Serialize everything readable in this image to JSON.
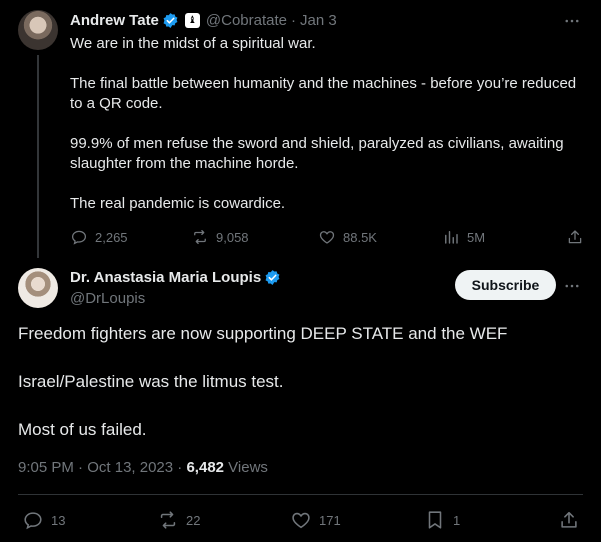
{
  "top_tweet": {
    "author_name": "Andrew Tate",
    "handle": "@Cobratate",
    "separator": "·",
    "date": "Jan 3",
    "affiliate_badge_glyph": "♝",
    "paragraphs": [
      "We are in the midst of a spiritual war.",
      "The final battle between humanity and the machines - before you’re reduced to a QR code.",
      "99.9% of men refuse the sword and shield, paralyzed as civilians, awaiting slaughter from the machine horde.",
      "The real pandemic is cowardice."
    ],
    "actions": {
      "replies": "2,265",
      "reposts": "9,058",
      "likes": "88.5K",
      "views": "5M"
    }
  },
  "main_tweet": {
    "author_name": "Dr. Anastasia Maria Loupis",
    "handle": "@DrLoupis",
    "subscribe_label": "Subscribe",
    "paragraphs": [
      "Freedom fighters are now supporting DEEP STATE and the WEF",
      "Israel/Palestine was the litmus test.",
      "Most of us failed."
    ],
    "meta": {
      "time": "9:05 PM",
      "separator1": " · ",
      "date": "Oct 13, 2023",
      "separator2": " · ",
      "views_count": "6,482",
      "views_label": " Views"
    },
    "actions": {
      "replies": "13",
      "reposts": "22",
      "likes": "171",
      "bookmarks": "1"
    }
  },
  "colors": {
    "background": "#000000",
    "text": "#e7e9ea",
    "muted": "#71767b",
    "verified": "#1d9bf0",
    "divider": "#2f3336"
  },
  "icons": [
    "more-icon",
    "verified-icon",
    "reply-icon",
    "repost-icon",
    "like-icon",
    "views-icon",
    "share-icon",
    "bookmark-icon"
  ]
}
